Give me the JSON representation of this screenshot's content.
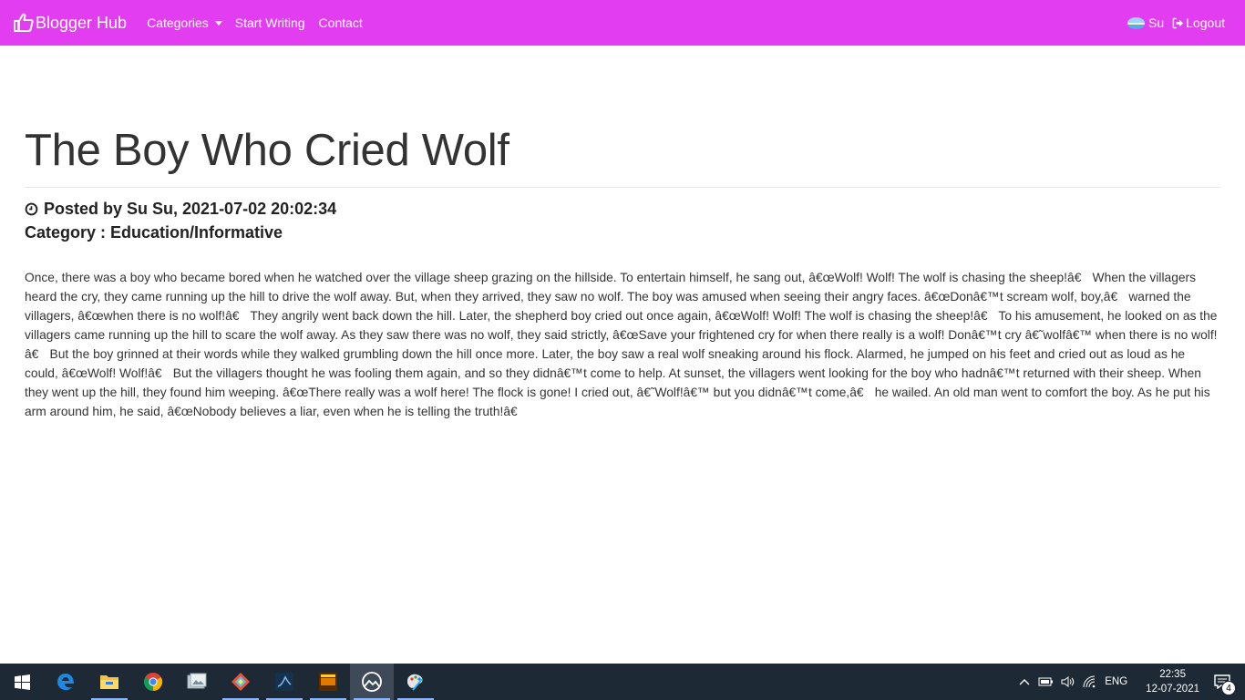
{
  "navbar": {
    "brand": "Blogger Hub",
    "links": {
      "categories": "Categories",
      "start_writing": "Start Writing",
      "contact": "Contact"
    },
    "user": "Su",
    "logout": "Logout",
    "bg_color": "#e23df0"
  },
  "post": {
    "title": "The Boy Who Cried Wolf",
    "posted_by": "Posted by Su Su, 2021-07-02 20:02:34",
    "category": "Category : Education/Informative",
    "body": "Once, there was a boy who became bored when he watched over the village sheep grazing on the hillside. To entertain himself, he sang out, â€œWolf! Wolf! The wolf is chasing the sheep!â€ When the villagers heard the cry, they came running up the hill to drive the wolf away. But, when they arrived, they saw no wolf. The boy was amused when seeing their angry faces. â€œDonâ€™t scream wolf, boy,â€ warned the villagers, â€œwhen there is no wolf!â€ They angrily went back down the hill. Later, the shepherd boy cried out once again, â€œWolf! Wolf! The wolf is chasing the sheep!â€ To his amusement, he looked on as the villagers came running up the hill to scare the wolf away. As they saw there was no wolf, they said strictly, â€œSave your frightened cry for when there really is a wolf! Donâ€™t cry â€˜wolfâ€™ when there is no wolf!â€ But the boy grinned at their words while they walked grumbling down the hill once more. Later, the boy saw a real wolf sneaking around his flock. Alarmed, he jumped on his feet and cried out as loud as he could, â€œWolf! Wolf!â€ But the villagers thought he was fooling them again, and so they didnâ€™t come to help. At sunset, the villagers went looking for the boy who hadnâ€™t returned with their sheep. When they went up the hill, they found him weeping. â€œThere really was a wolf here! The flock is gone! I cried out, â€˜Wolf!â€™ but you didnâ€™t come,â€ he wailed. An old man went to comfort the boy. As he put his arm around him, he said, â€œNobody believes a liar, even when he is telling the truth!â€"
  },
  "taskbar": {
    "apps": [
      {
        "icon": "windows-start-icon"
      },
      {
        "icon": "edge-icon"
      },
      {
        "icon": "file-explorer-icon"
      },
      {
        "icon": "chrome-icon"
      },
      {
        "icon": "photos-icon"
      },
      {
        "icon": "git-icon"
      },
      {
        "icon": "mysql-workbench-icon"
      },
      {
        "icon": "xampp-icon"
      },
      {
        "icon": "browser-app-icon",
        "active": true
      },
      {
        "icon": "paint-icon"
      }
    ],
    "language": "ENG",
    "time": "22:35",
    "date": "12-07-2021",
    "notifications": "4"
  }
}
